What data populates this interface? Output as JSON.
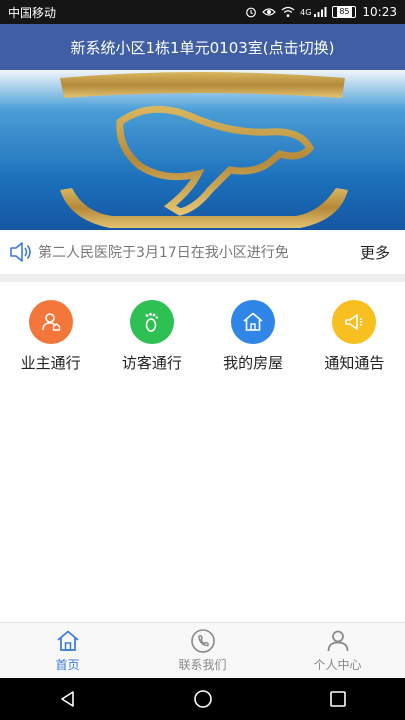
{
  "status_bar": {
    "carrier": "中国移动",
    "network": "4G",
    "battery": "85",
    "time": "10:23",
    "icons": [
      "alarm-icon",
      "eye-icon",
      "wifi-icon",
      "signal-icon",
      "battery-icon"
    ]
  },
  "header": {
    "title": "新系统小区1栋1单元0103室(点击切换)",
    "bg_color": "#3f5ea3"
  },
  "banner": {
    "image": "gold-logo-on-blue-background"
  },
  "notice": {
    "icon": "speaker-icon",
    "text": "第二人民医院于3月17日在我小区进行免",
    "more_label": "更多"
  },
  "grid": {
    "items": [
      {
        "label": "业主通行",
        "icon": "owner-icon",
        "color": "#f3773a"
      },
      {
        "label": "访客通行",
        "icon": "footprint-icon",
        "color": "#2ec052"
      },
      {
        "label": "我的房屋",
        "icon": "house-icon",
        "color": "#2f86e6"
      },
      {
        "label": "通知通告",
        "icon": "megaphone-icon",
        "color": "#f7c020"
      }
    ]
  },
  "tabbar": {
    "tabs": [
      {
        "label": "首页",
        "icon": "home-icon",
        "active": true
      },
      {
        "label": "联系我们",
        "icon": "phone-icon",
        "active": false
      },
      {
        "label": "个人中心",
        "icon": "user-icon",
        "active": false
      }
    ],
    "active_color": "#3a7bd5"
  },
  "nav_bar": {
    "buttons": [
      "back-icon",
      "home-circle-icon",
      "recents-icon"
    ]
  }
}
